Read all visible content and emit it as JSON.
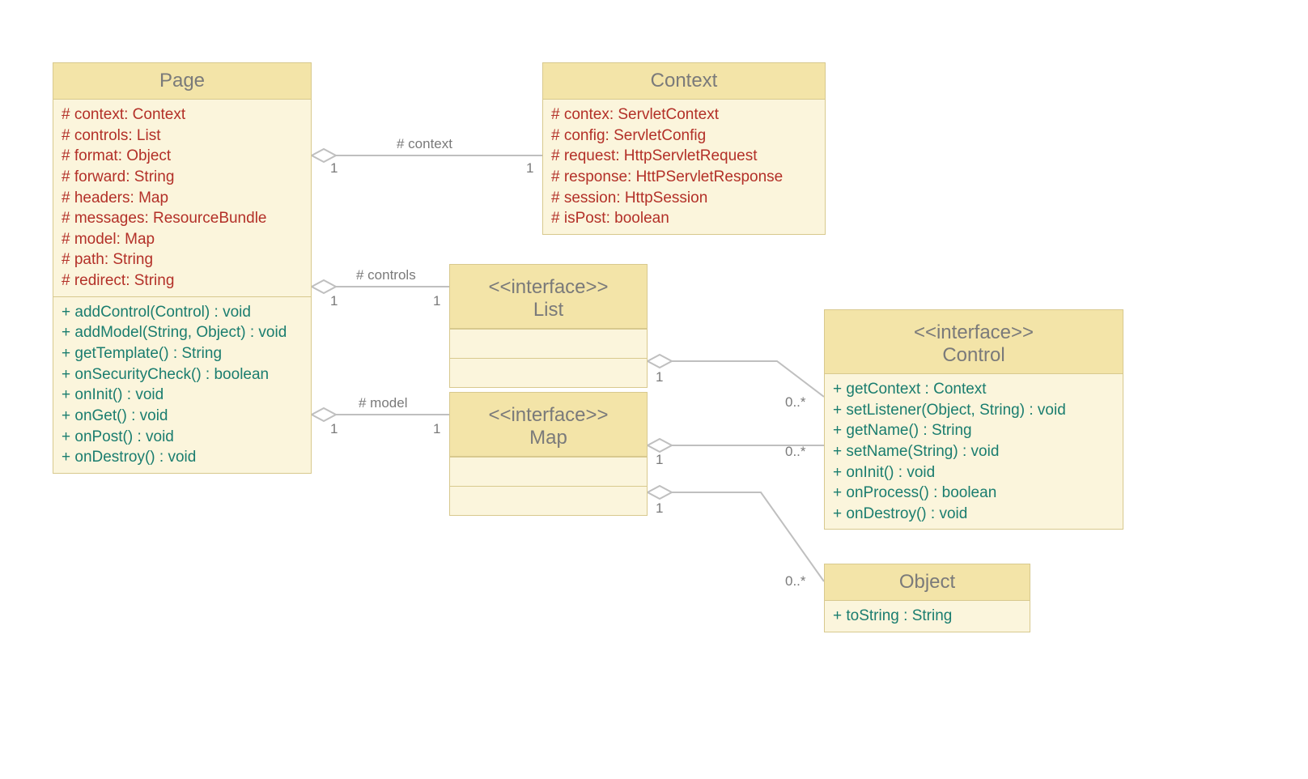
{
  "classes": {
    "page": {
      "name": "Page",
      "attributes": [
        "# context: Context",
        "# controls: List",
        "# format: Object",
        "# forward: String",
        "# headers: Map",
        "# messages: ResourceBundle",
        "# model: Map",
        "# path: String",
        "# redirect: String"
      ],
      "methods": [
        "+ addControl(Control) : void",
        "+ addModel(String, Object) : void",
        "+ getTemplate() : String",
        "+ onSecurityCheck() : boolean",
        "+ onInit() : void",
        "+ onGet() : void",
        "+ onPost() : void",
        "+ onDestroy() : void"
      ]
    },
    "context": {
      "name": "Context",
      "attributes": [
        "# contex: ServletContext",
        "# config: ServletConfig",
        "# request: HttpServletRequest",
        "# response: HttPServletResponse",
        "# session: HttpSession",
        "# isPost: boolean"
      ]
    },
    "list": {
      "stereotype": "<<interface>>",
      "name": "List"
    },
    "map": {
      "stereotype": "<<interface>>",
      "name": "Map"
    },
    "control": {
      "stereotype": "<<interface>>",
      "name": "Control",
      "methods": [
        "+ getContext : Context",
        "+ setListener(Object, String) : void",
        "+ getName() : String",
        "+ setName(String) : void",
        "+ onInit() : void",
        "+ onProcess() : boolean",
        "+ onDestroy() : void"
      ]
    },
    "object": {
      "name": "Object",
      "methods": [
        "+ toString : String"
      ]
    }
  },
  "labels": {
    "context_role": "# context",
    "controls_role": "# controls",
    "model_role": "# model",
    "one": "1",
    "zero_many": "0..*"
  }
}
